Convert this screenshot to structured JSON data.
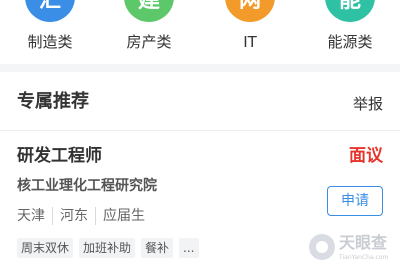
{
  "categories": [
    {
      "label": "制造类",
      "icon_char": "汇",
      "color": "#3a8ee6",
      "icon": "manufacturing-icon"
    },
    {
      "label": "房产类",
      "icon_char": "建",
      "color": "#5cc86a",
      "icon": "real-estate-icon"
    },
    {
      "label": "IT",
      "icon_char": "网",
      "color": "#f39b2a",
      "icon": "it-icon"
    },
    {
      "label": "能源类",
      "icon_char": "能",
      "color": "#2fc1a3",
      "icon": "energy-icon"
    }
  ],
  "recommend": {
    "title": "专属推荐",
    "report_label": "举报"
  },
  "job": {
    "title": "研发工程师",
    "salary": "面议",
    "company": "核工业理化工程研究院",
    "meta": [
      "天津",
      "河东",
      "应届生"
    ],
    "tags": [
      "周末双休",
      "加班补助",
      "餐补",
      "..."
    ],
    "apply_label": "申请"
  },
  "watermark": {
    "name": "天眼查",
    "url": "TianYanCha.com"
  }
}
